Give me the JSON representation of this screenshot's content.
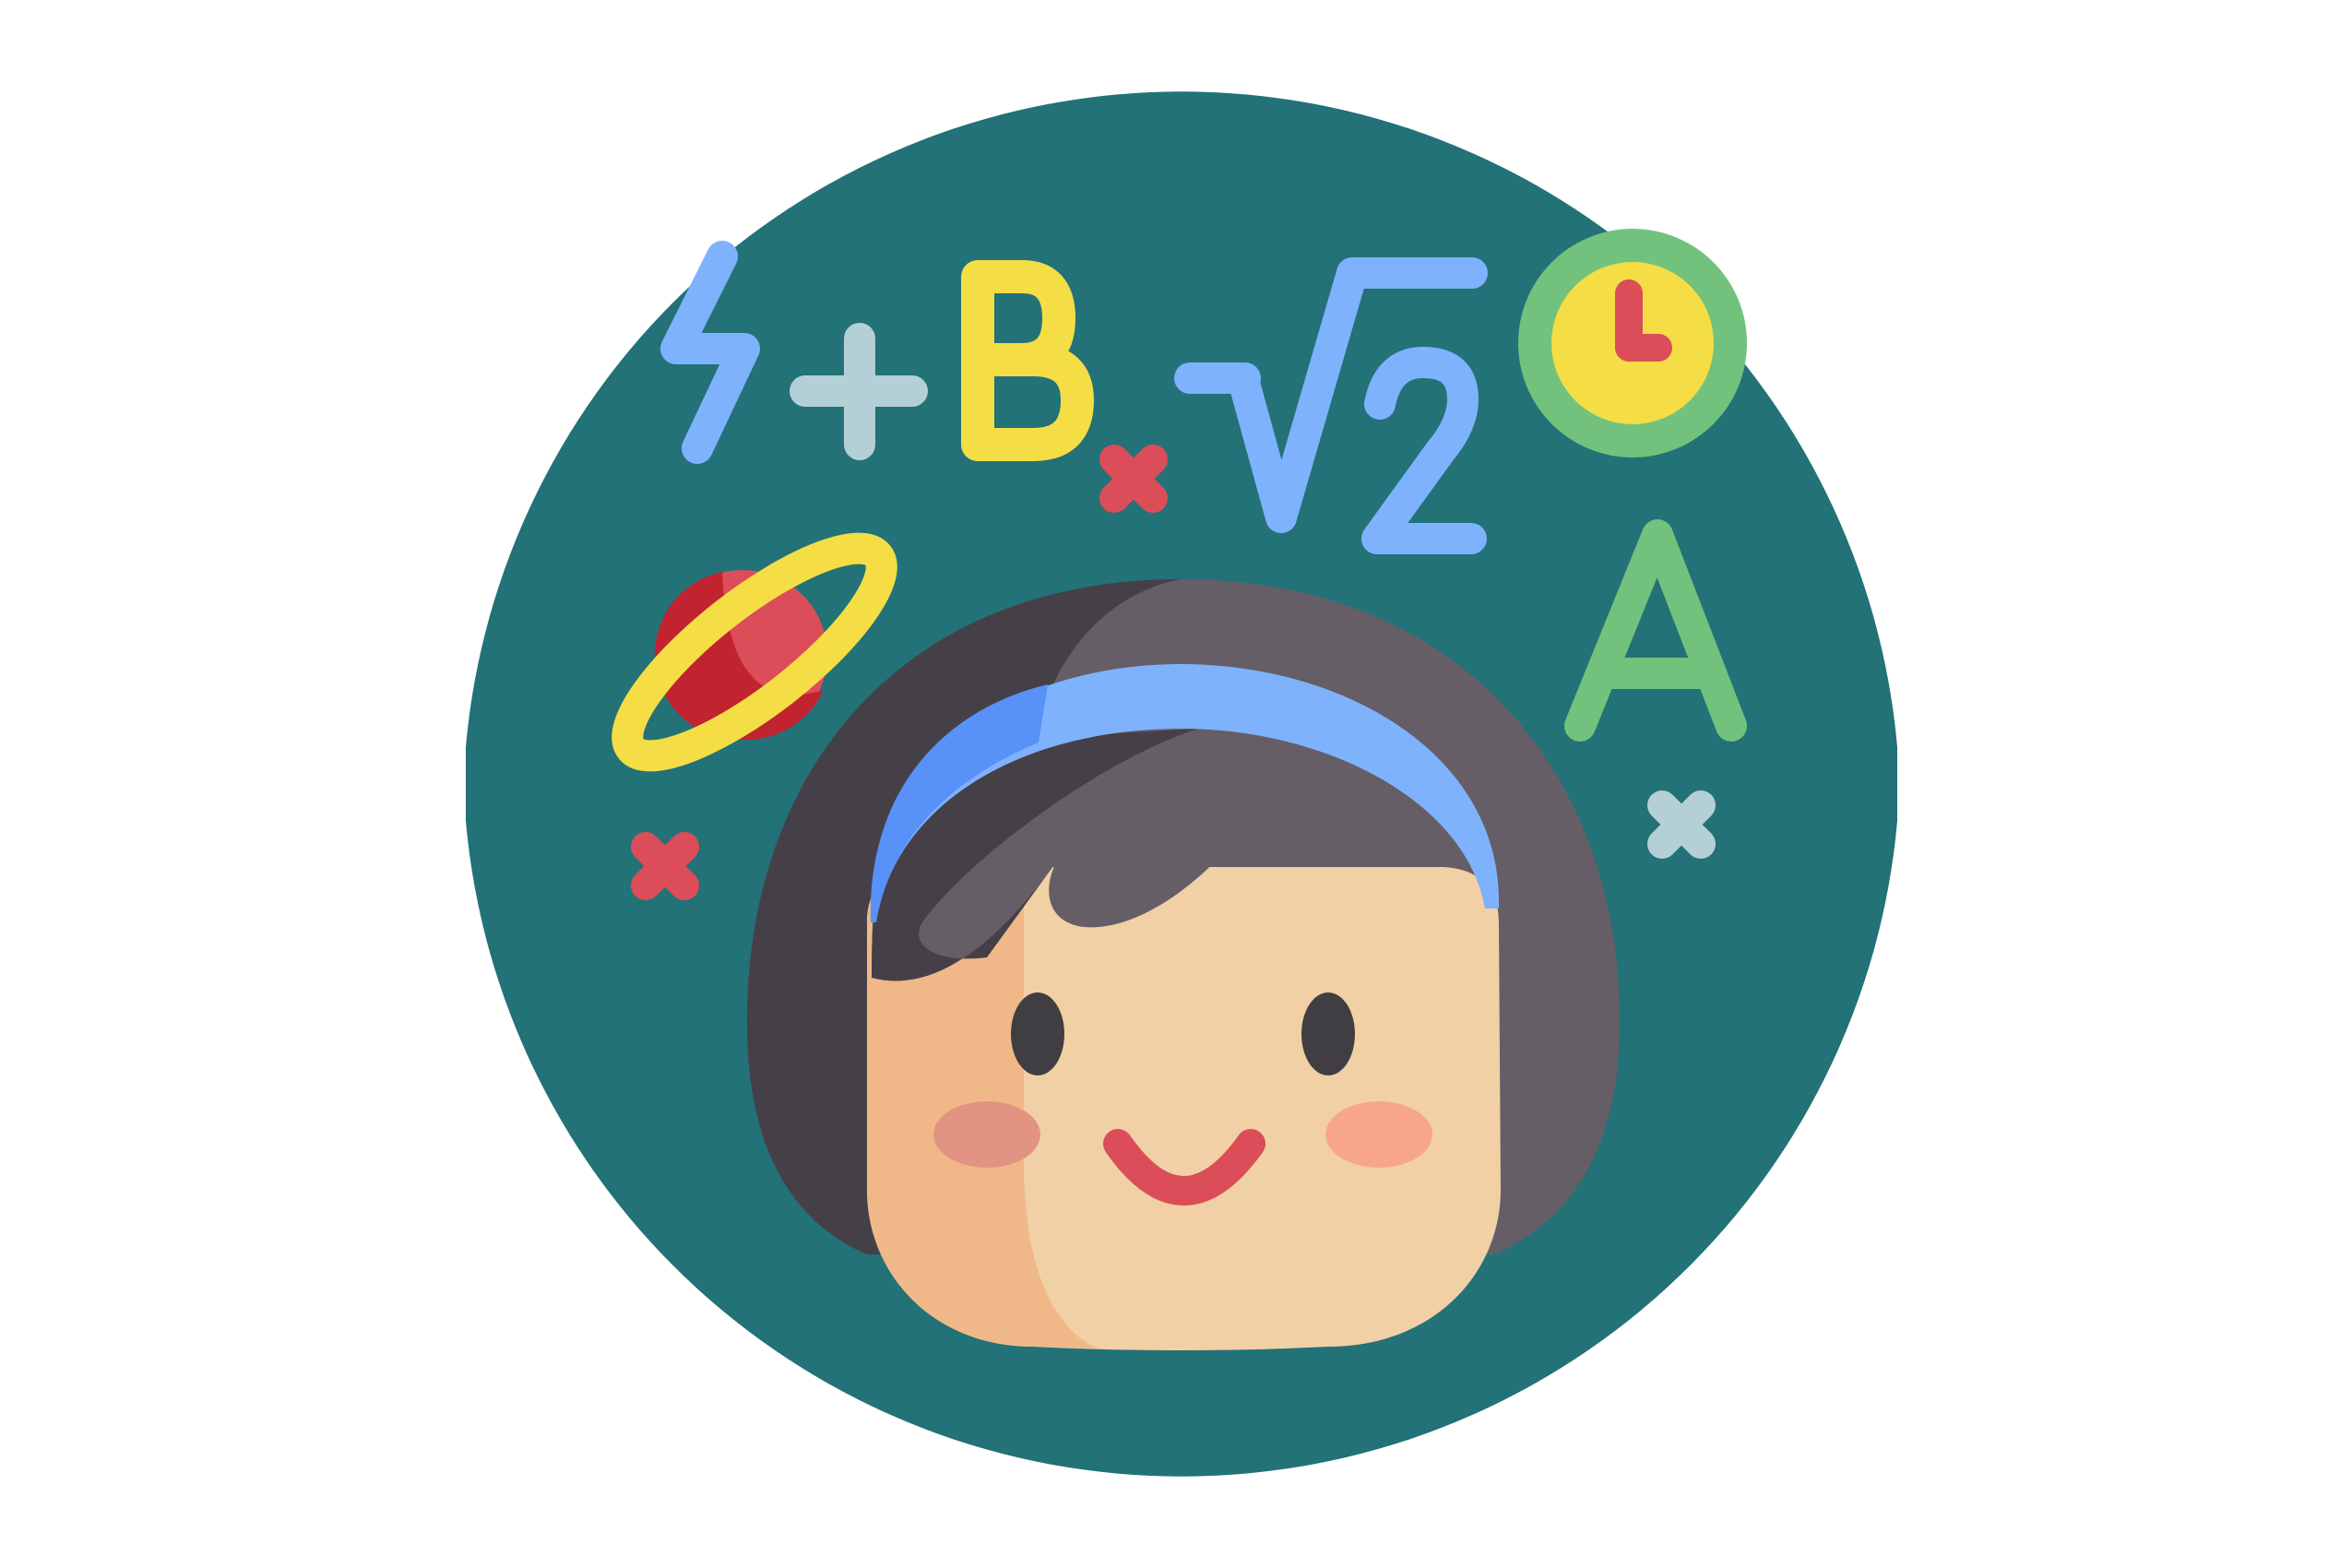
{
  "illustration": {
    "symbols": {
      "letter_b": "B",
      "plus_sign": "+",
      "letter_a": "A"
    },
    "colors": {
      "background": "#ffffff",
      "circle": "#227277",
      "light_blue": "#7fb2fc",
      "mid_blue": "#5891f8",
      "yellow": "#f4dd45",
      "red": "#db4d58",
      "dark_red": "#c12330",
      "green": "#72c27d",
      "grey_blue": "#b4cfd5",
      "hair_dark": "#454048",
      "hair_light": "#655e67",
      "skin_light": "#f1d0a6",
      "skin_shade": "#f0b888",
      "blush_left": "#e39382",
      "blush_right": "#f8a68a",
      "eye": "#413e43"
    },
    "icons": [
      "lightning-icon",
      "plus-icon",
      "letter-b-icon",
      "minus-icon",
      "square-root-two-icon",
      "clock-icon",
      "planet-icon",
      "letter-a-icon",
      "cross-icon",
      "girl-face-icon",
      "headband-icon"
    ]
  }
}
